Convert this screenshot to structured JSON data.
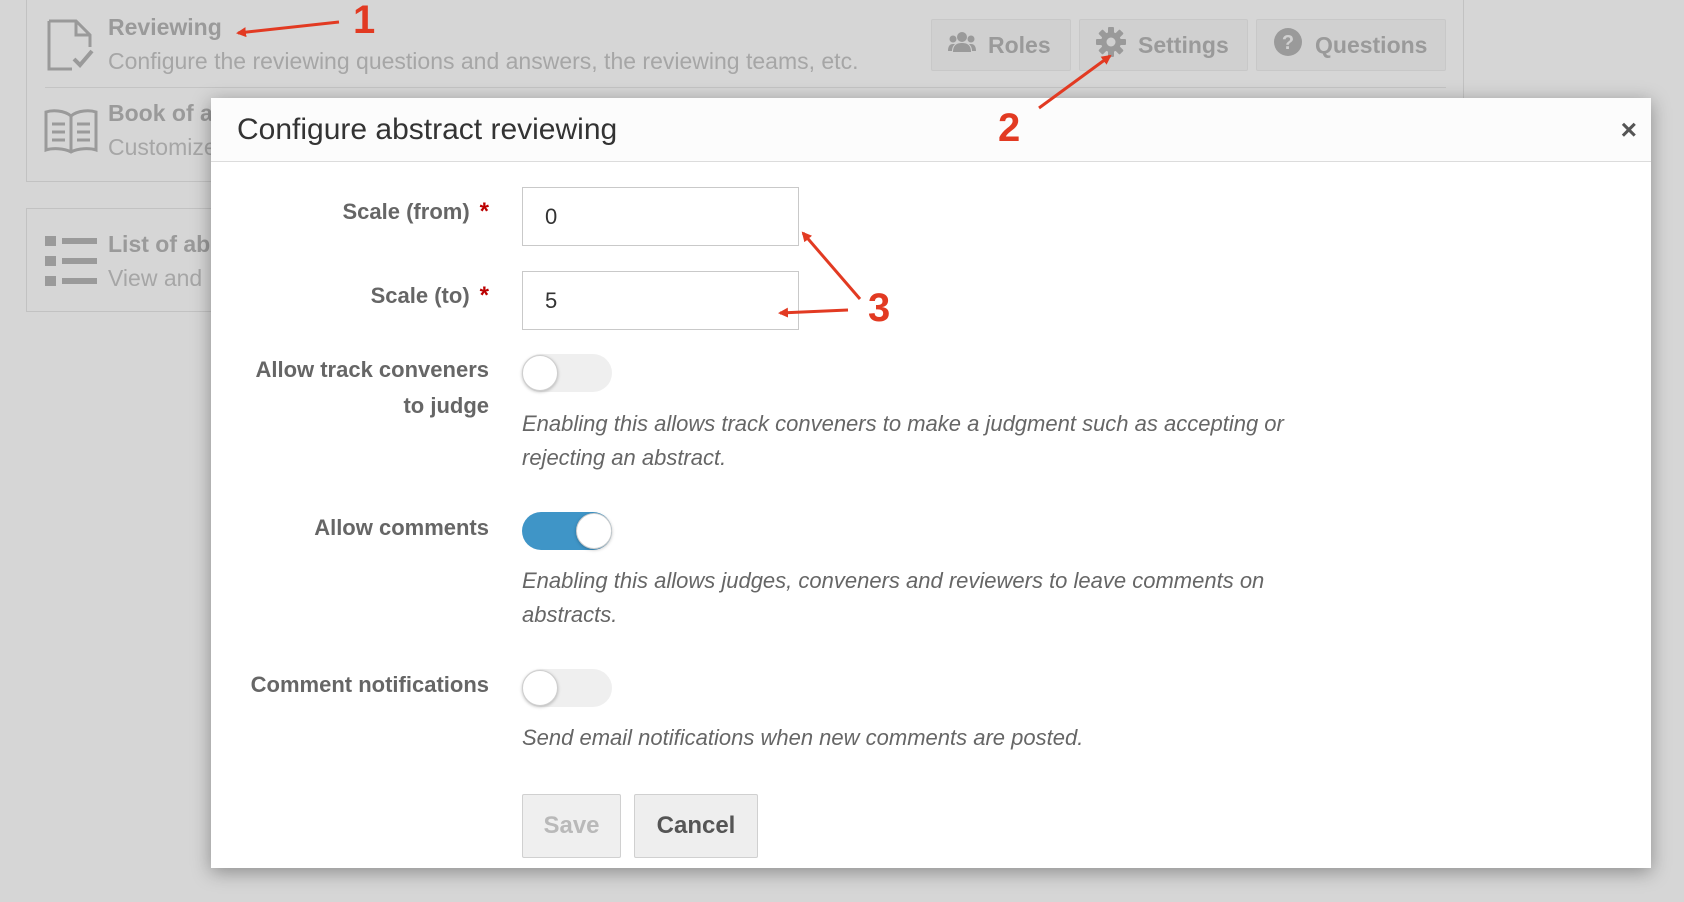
{
  "background": {
    "rows": [
      {
        "title": "Reviewing",
        "description": "Configure the reviewing questions and answers, the reviewing teams, etc.",
        "icon": "document-check-icon"
      },
      {
        "title": "Book of a",
        "description": "Customize",
        "icon": "book-icon"
      }
    ],
    "panel2": {
      "title": "List of ab",
      "description": "View and",
      "icon": "list-icon"
    },
    "buttons": [
      {
        "label": "Roles",
        "icon": "users-icon"
      },
      {
        "label": "Settings",
        "icon": "gear-icon"
      },
      {
        "label": "Questions",
        "icon": "question-circle-icon"
      }
    ]
  },
  "modal": {
    "title": "Configure abstract reviewing",
    "close_glyph": "×",
    "fields": {
      "scale_from": {
        "label": "Scale (from)",
        "value": "0",
        "required_mark": "*"
      },
      "scale_to": {
        "label": "Scale (to)",
        "value": "5",
        "required_mark": "*"
      },
      "allow_track_conveners": {
        "label_line1": "Allow track conveners",
        "label_line2": "to judge",
        "enabled": false,
        "help": "Enabling this allows track conveners to make a judgment such as accepting or rejecting an abstract."
      },
      "allow_comments": {
        "label": "Allow comments",
        "enabled": true,
        "help": "Enabling this allows judges, conveners and reviewers to leave comments on abstracts."
      },
      "comment_notifications": {
        "label": "Comment notifications",
        "enabled": false,
        "help": "Send email notifications when new comments are posted."
      }
    },
    "buttons": {
      "save": "Save",
      "cancel": "Cancel"
    }
  },
  "annotations": {
    "one": "1",
    "two": "2",
    "three": "3"
  },
  "colors": {
    "annotation": "#e23a22",
    "toggle_on": "#3f95c7",
    "required": "#bb0000"
  }
}
